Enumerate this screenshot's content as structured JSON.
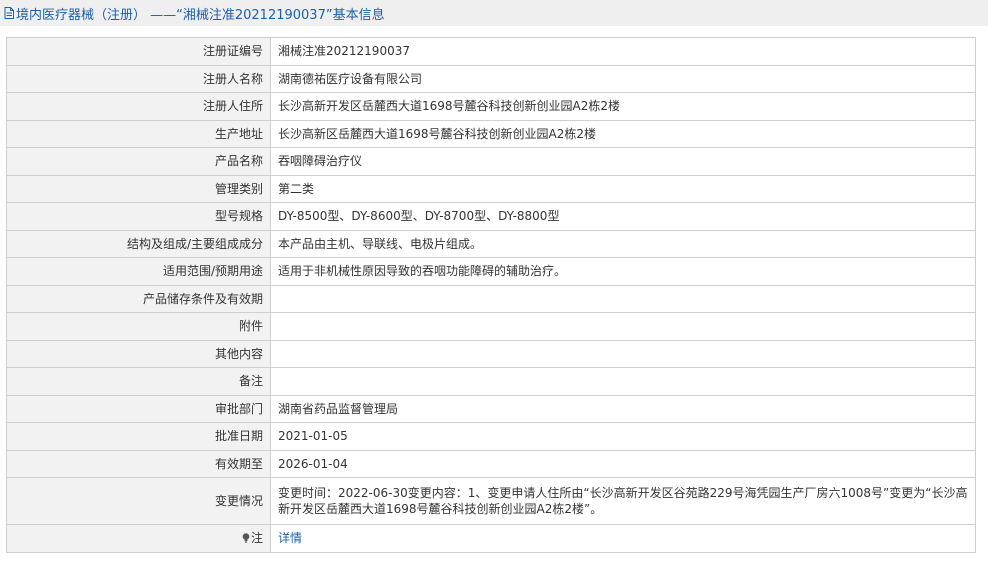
{
  "page": {
    "title": "境内医疗器械（注册） ——“湘械注准20212190037”基本信息",
    "title_icon": "document-icon"
  },
  "colors": {
    "title_text": "#1f5fa8",
    "label_bg": "#f2f2f2",
    "border": "#cfcfcf",
    "link": "#1f5fa8"
  },
  "rows": [
    {
      "label": "注册证编号",
      "value": "湘械注准20212190037"
    },
    {
      "label": "注册人名称",
      "value": "湖南德祐医疗设备有限公司"
    },
    {
      "label": "注册人住所",
      "value": "长沙高新开发区岳麓西大道1698号麓谷科技创新创业园A2栋2楼"
    },
    {
      "label": "生产地址",
      "value": "长沙高新区岳麓西大道1698号麓谷科技创新创业园A2栋2楼"
    },
    {
      "label": "产品名称",
      "value": "吞咽障碍治疗仪"
    },
    {
      "label": "管理类别",
      "value": "第二类"
    },
    {
      "label": "型号规格",
      "value": "DY-8500型、DY-8600型、DY-8700型、DY-8800型"
    },
    {
      "label": "结构及组成/主要组成成分",
      "value": "本产品由主机、导联线、电极片组成。"
    },
    {
      "label": "适用范围/预期用途",
      "value": "适用于非机械性原因导致的吞咽功能障碍的辅助治疗。"
    },
    {
      "label": "产品储存条件及有效期",
      "value": ""
    },
    {
      "label": "附件",
      "value": ""
    },
    {
      "label": "其他内容",
      "value": ""
    },
    {
      "label": "备注",
      "value": ""
    },
    {
      "label": "审批部门",
      "value": "湖南省药品监督管理局"
    },
    {
      "label": "批准日期",
      "value": "2021-01-05"
    },
    {
      "label": "有效期至",
      "value": "2026-01-04"
    },
    {
      "label": "变更情况",
      "value": "变更时间：2022-06-30变更内容：1、变更申请人住所由“长沙高新开发区谷苑路229号海凭园生产厂房六1008号”变更为“长沙高新开发区岳麓西大道1698号麓谷科技创新创业园A2栋2楼”。"
    }
  ],
  "note": {
    "label": "注",
    "icon": "lightbulb-icon",
    "link_text": "详情"
  }
}
